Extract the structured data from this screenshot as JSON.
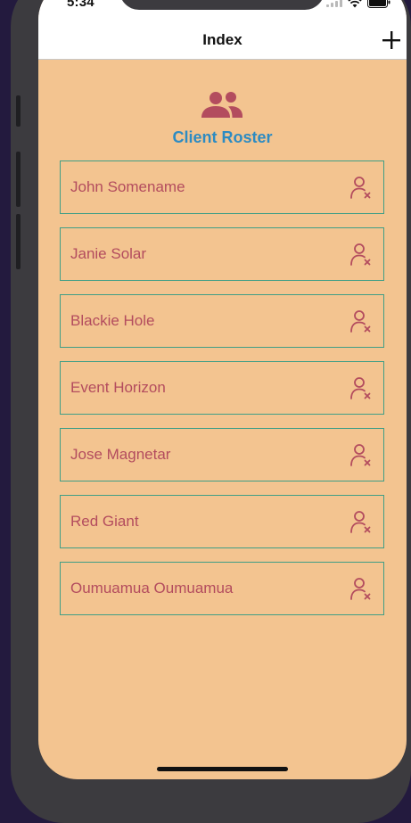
{
  "status_bar": {
    "time": "5:34"
  },
  "nav": {
    "title": "Index",
    "add_icon": "plus-icon"
  },
  "header": {
    "icon": "people-icon",
    "title": "Client Roster"
  },
  "clients": [
    {
      "name": "John Somename"
    },
    {
      "name": "Janie Solar"
    },
    {
      "name": "Blackie Hole"
    },
    {
      "name": "Event Horizon"
    },
    {
      "name": "Jose Magnetar"
    },
    {
      "name": "Red Giant"
    },
    {
      "name": "Oumuamua Oumuamua"
    }
  ],
  "row_action_icon": "remove-user-icon",
  "colors": {
    "background": "#f3c490",
    "title": "#2d8bc2",
    "accent": "#b34c5e",
    "row_border": "#3f9e86"
  }
}
